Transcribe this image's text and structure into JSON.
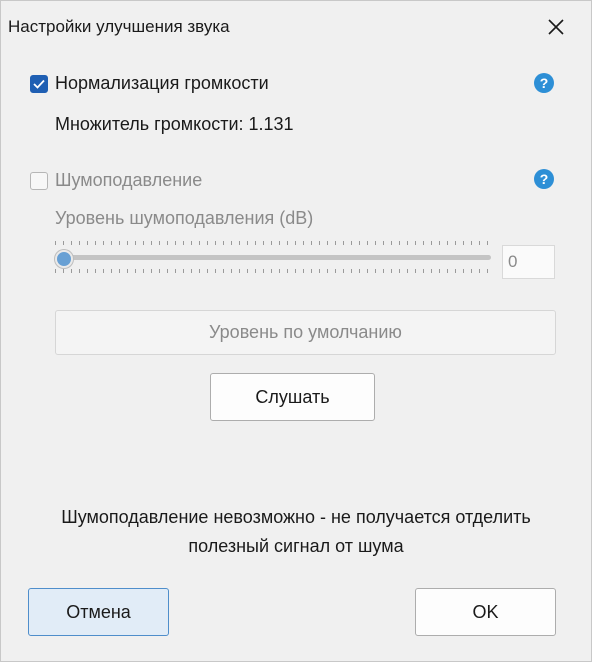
{
  "window": {
    "title": "Настройки улучшения звука"
  },
  "normalization": {
    "label": "Нормализация громкости",
    "checked": true,
    "multiplier_text": "Множитель громкости: 1.131"
  },
  "noise_reduction": {
    "label": "Шумоподавление",
    "checked": false,
    "level_label": "Уровень шумоподавления (dB)",
    "slider_value": 0,
    "input_value": "0"
  },
  "buttons": {
    "default_level": "Уровень по умолчанию",
    "listen": "Слушать",
    "cancel": "Отмена",
    "ok": "OK"
  },
  "status": {
    "line1": "Шумоподавление невозможно - не получается отделить",
    "line2": "полезный сигнал от шума"
  },
  "help_icon_glyph": "?",
  "colors": {
    "accent": "#1f5fb3",
    "help": "#2d8fd6",
    "disabled": "#8a8a8a"
  }
}
